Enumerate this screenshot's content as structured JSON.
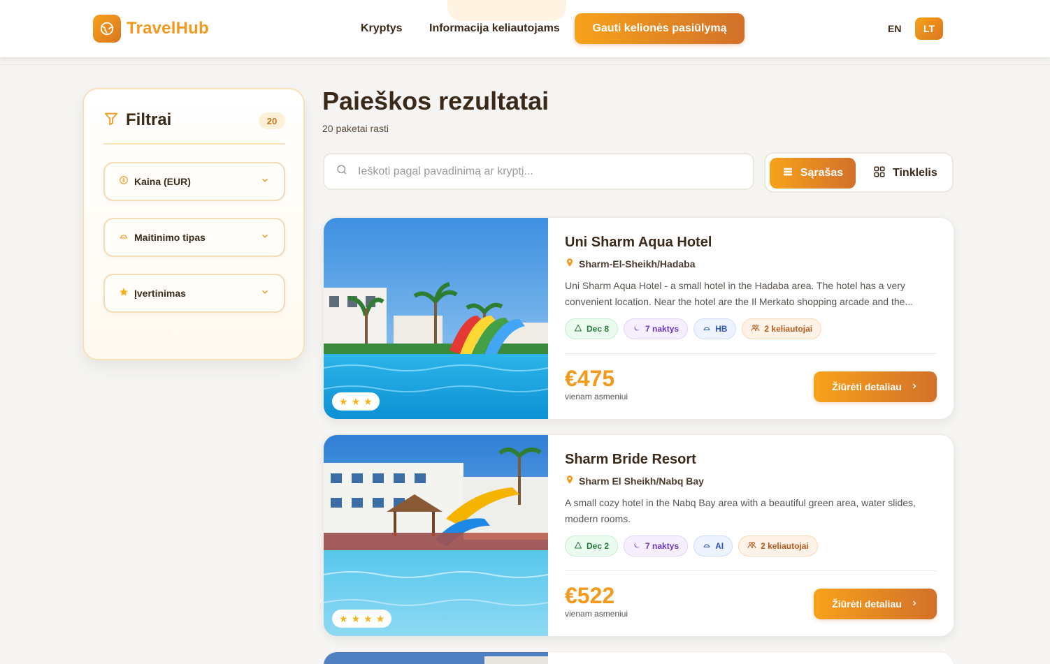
{
  "header": {
    "brand": "TravelHub",
    "nav": [
      "Kryptys",
      "Informacija keliautojams"
    ],
    "cta": "Gauti kelionės pasiūlymą",
    "lang_en": "EN",
    "lang_lt": "LT"
  },
  "filters": {
    "title": "Filtrai",
    "count": "20",
    "items": [
      {
        "label": "Kaina (EUR)",
        "icon": "coin-icon"
      },
      {
        "label": "Maitinimo tipas",
        "icon": "dish-icon"
      },
      {
        "label": "Įvertinimas",
        "icon": "star-icon"
      }
    ]
  },
  "main": {
    "title": "Paieškos rezultatai",
    "count_text": "20 paketai rasti",
    "search_placeholder": "Ieškoti pagal pavadinimą ar kryptį...",
    "view_list": "Sąrašas",
    "view_grid": "Tinklelis"
  },
  "results": [
    {
      "name": "Uni Sharm Aqua Hotel",
      "location": "Sharm-El-Sheikh/Hadaba",
      "description": "Uni Sharm Aqua Hotel - a small hotel in the Hadaba area. The hotel has a very convenient location. Near the hotel are the Il Merkato shopping arcade and the...",
      "date": "Dec 8",
      "nights": "7 naktys",
      "board": "HB",
      "travelers": "2 keliautojai",
      "price": "€475",
      "per": "vienam asmeniui",
      "button": "Žiūrėti detaliau",
      "stars": 3
    },
    {
      "name": "Sharm Bride Resort",
      "location": "Sharm El Sheikh/Nabq Bay",
      "description": "A small cozy hotel in the Nabq Bay area with a beautiful green area, water slides, modern rooms.",
      "date": "Dec 2",
      "nights": "7 naktys",
      "board": "AI",
      "travelers": "2 keliautojai",
      "price": "€522",
      "per": "vienam asmeniui",
      "button": "Žiūrėti detaliau",
      "stars": 4
    }
  ],
  "colors": {
    "accent": "#f7a21b",
    "accent_dark": "#d2702a",
    "text": "#3b2a1a"
  }
}
